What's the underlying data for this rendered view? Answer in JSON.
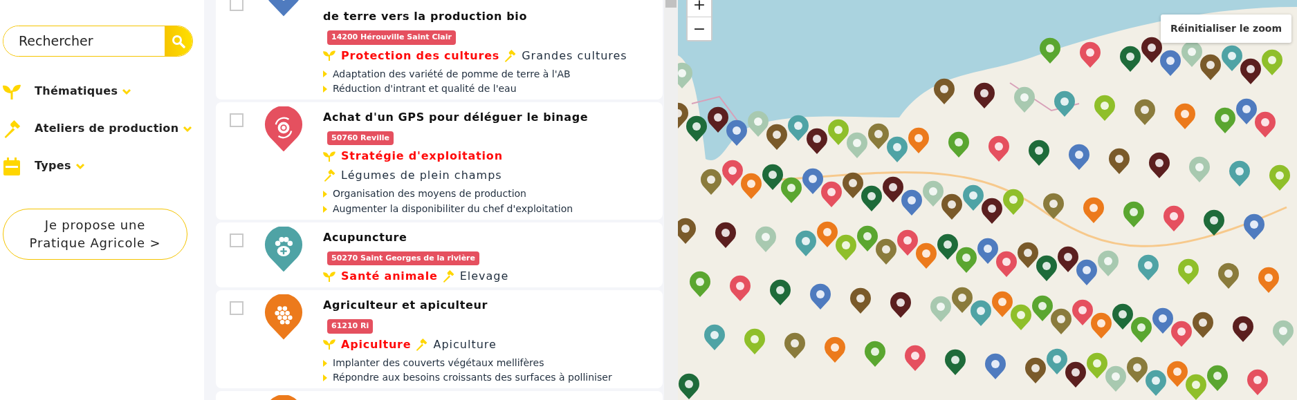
{
  "search": {
    "placeholder": "Rechercher"
  },
  "filters": [
    {
      "label": "Thématiques",
      "expanded": false
    },
    {
      "label": "Ateliers de production",
      "expanded": false
    },
    {
      "label": "Types",
      "expanded": false
    }
  ],
  "propose_button": "Je propose une Pratique Agricole >",
  "practices": [
    {
      "checked": false,
      "color": "#4f7bbf",
      "title": "de terre vers la production bio",
      "location": "14200 Hérouville Saint Clair",
      "theme": "Protection des cultures",
      "workshop": "Grandes cultures",
      "goals": [
        "Adaptation des variété de pomme de terre à l'AB",
        "Réduction d'intrant et qualité de l'eau"
      ]
    },
    {
      "checked": false,
      "color": "#e5505f",
      "title": "Achat d'un GPS pour déléguer le binage",
      "location": "50760 Reville",
      "theme": "Stratégie d'exploitation",
      "workshop": "Légumes de plein champs",
      "goals": [
        "Organisation des moyens de production",
        "Augmenter la disponibiliter du chef d'exploitation"
      ]
    },
    {
      "checked": false,
      "color": "#4fa3a5",
      "title": "Acupuncture",
      "location": "50270 Saint Georges de la rivière",
      "theme": "Santé animale",
      "workshop": "Elevage"
    },
    {
      "checked": false,
      "color": "#ec7a1c",
      "title": "Agriculteur et apiculteur",
      "location": "61210 Ri",
      "theme": "Apiculture",
      "workshop": "Apiculture",
      "goals": [
        "Implanter des couverts végétaux mellifères",
        "Répondre aux besoins croissants des surfaces à polliniser"
      ]
    },
    {
      "color": "#ec7a1c"
    }
  ],
  "map": {
    "zoom_in": "+",
    "zoom_out": "−",
    "reset_zoom": "Réinitialiser le zoom"
  }
}
